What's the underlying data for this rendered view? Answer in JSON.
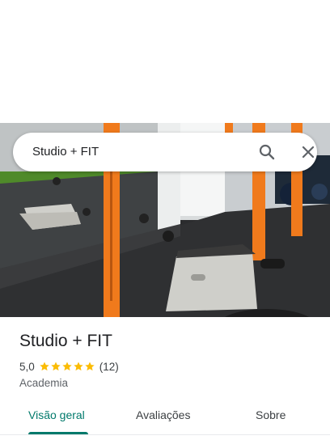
{
  "search": {
    "query": "Studio + FIT",
    "search_icon": "search-icon",
    "close_icon": "close-icon"
  },
  "photo": {
    "description_icon": "gym-photo"
  },
  "place": {
    "name": "Studio + FIT",
    "rating": "5,0",
    "stars": 5,
    "review_count": "(12)",
    "category": "Academia",
    "star_color": "#fbbc04"
  },
  "tabs": [
    {
      "label": "Visão geral",
      "active": true
    },
    {
      "label": "Avaliações",
      "active": false
    },
    {
      "label": "Sobre",
      "active": false
    }
  ],
  "colors": {
    "accent": "#00796b",
    "text_primary": "#202124",
    "text_secondary": "#5f6368"
  }
}
